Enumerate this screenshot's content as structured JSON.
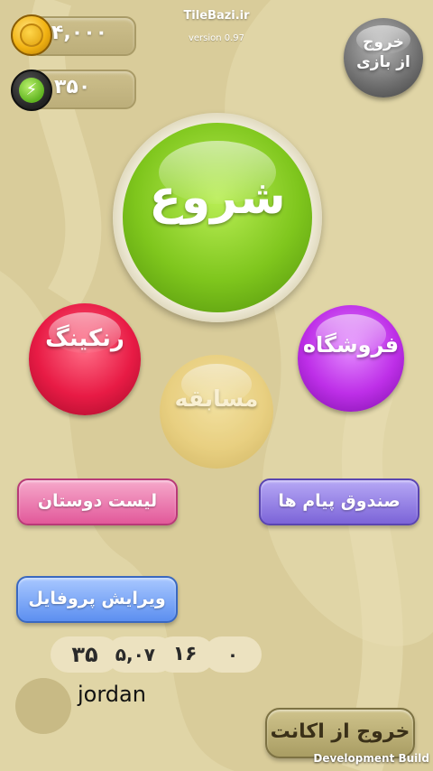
{
  "header": {
    "site_name": "TileBazi.ir",
    "version": "version 0.97"
  },
  "currency": {
    "coins": "۴,۰۰۰",
    "energy": "۳۵۰"
  },
  "buttons": {
    "exit_game": "خروج\nاز بازی",
    "start": "شروع",
    "ranking": "رنکینگ",
    "shop": "فروشگاه",
    "contest": "مسابقه",
    "friends_list": "لیست دوستان",
    "inbox": "صندوق پیام ها",
    "edit_profile": "ویرایش پروفایل",
    "logout": "خروج از اکانت"
  },
  "player": {
    "username": "jordan",
    "stats": [
      "۳۵",
      "۵,۰۷۰",
      "۱۶",
      "۰"
    ]
  },
  "footer": {
    "build_label": "Development Build"
  },
  "colors": {
    "background": "#d9cc9a",
    "start": "#7fc61d",
    "ranking": "#e81b45",
    "shop": "#be2fe8",
    "contest": "#ebd07c",
    "friends": "#e2599a",
    "inbox": "#7c64d8",
    "profile": "#5c8ff0"
  }
}
